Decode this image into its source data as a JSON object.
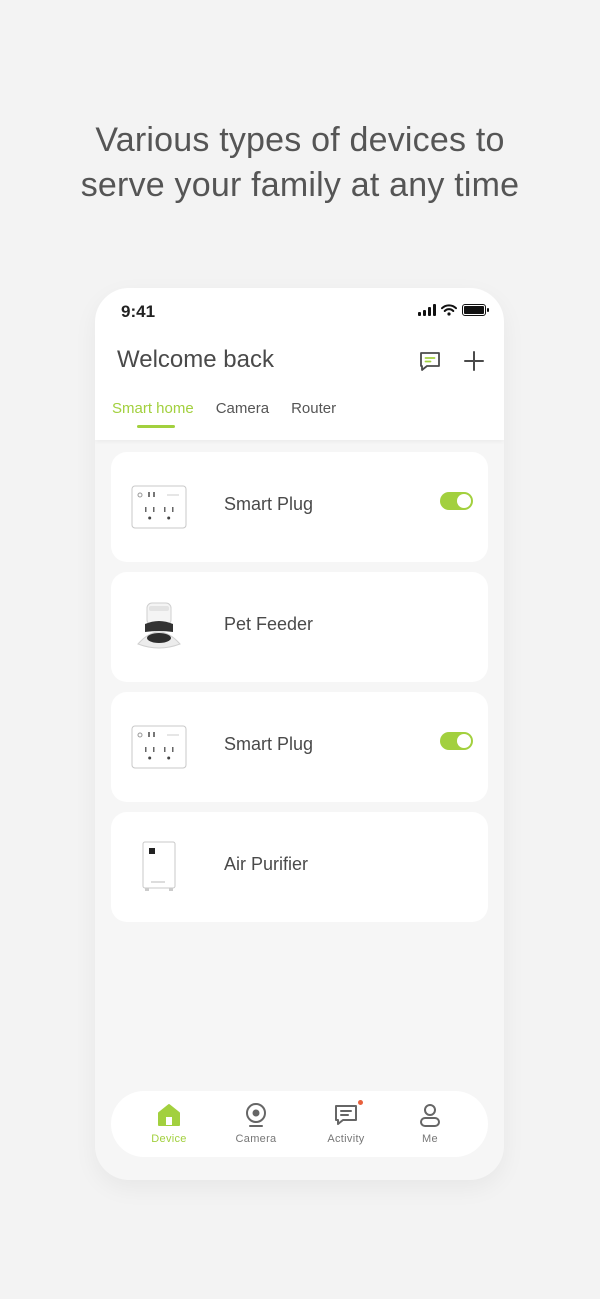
{
  "headline": {
    "line1": "Various types of devices to",
    "line2": "serve your family at any time"
  },
  "status_bar": {
    "time": "9:41"
  },
  "header": {
    "title": "Welcome back",
    "message_icon": "message-icon",
    "add_icon": "plus-icon"
  },
  "tabs": [
    {
      "label": "Smart home",
      "active": true
    },
    {
      "label": "Camera",
      "active": false
    },
    {
      "label": "Router",
      "active": false
    }
  ],
  "devices": [
    {
      "name": "Smart Plug",
      "icon": "smart-plug-image",
      "toggle_on": true
    },
    {
      "name": "Pet Feeder",
      "icon": "pet-feeder-image"
    },
    {
      "name": "Smart Plug",
      "icon": "smart-plug-image",
      "toggle_on": true
    },
    {
      "name": "Air Purifier",
      "icon": "air-purifier-image"
    }
  ],
  "bottom_nav": [
    {
      "label": "Device",
      "icon": "home-icon",
      "active": true
    },
    {
      "label": "Camera",
      "icon": "camera-icon",
      "active": false
    },
    {
      "label": "Activity",
      "icon": "activity-icon",
      "active": false,
      "badge": true
    },
    {
      "label": "Me",
      "icon": "user-icon",
      "active": false
    }
  ],
  "colors": {
    "accent": "#a2d03e",
    "badge": "#e8603c",
    "background": "#f3f3f3"
  }
}
